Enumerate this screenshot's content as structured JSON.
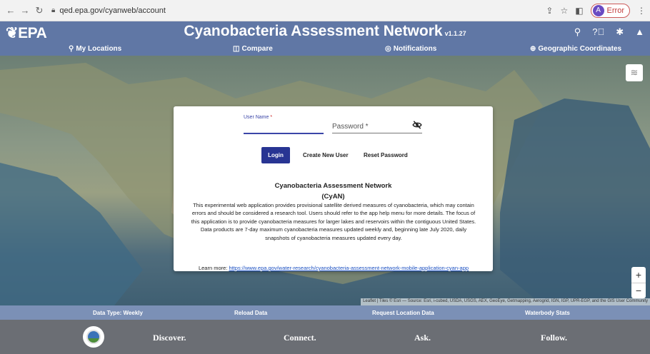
{
  "browser": {
    "url": "qed.epa.gov/cyanweb/account",
    "profile_initial": "A",
    "profile_status": "Error"
  },
  "header": {
    "logo": "EPA",
    "title": "Cyanobacteria Assessment Network",
    "version": "v1.1.27",
    "nav": {
      "my_locations": "My Locations",
      "compare": "Compare",
      "notifications": "Notifications",
      "geographic_coordinates": "Geographic Coordinates"
    }
  },
  "login": {
    "username_label": "User Name",
    "required_mark": "*",
    "password_label": "Password *",
    "login_button": "Login",
    "create_user": "Create New User",
    "reset_password": "Reset Password",
    "title_line1": "Cyanobacteria Assessment Network",
    "title_line2": "(CyAN)",
    "description": "This experimental web application provides provisional satellite derived measures of cyanobacteria, which may contain errors and should be considered a research tool. Users should refer to the app help menu for more details. The focus of this application is to provide cyanobacteria measures for larger lakes and reservoirs within the contiguous United States. Data products are 7-day maximum cyanobacteria measures updated weekly and, beginning late July 2020, daily snapshots of cyanobacteria measures updated every day.",
    "learn_more_label": "Learn more:",
    "learn_more_link": "https://www.epa.gov/water-research/cyanobacteria-assessment-network-mobile-application-cyan-app"
  },
  "map": {
    "zoom_in": "+",
    "zoom_out": "−",
    "attribution": "Leaflet | Tiles © Esri — Source: Esri, i-cubed, USDA, USGS, AEX, GeoEye, Getmapping, Aerogrid, IGN, IGP, UPR-EGP, and the GIS User Community"
  },
  "data_bar": {
    "data_type": "Data Type: Weekly",
    "reload": "Reload Data",
    "request": "Request Location Data",
    "waterbody": "Waterbody Stats"
  },
  "footer": {
    "discover": "Discover.",
    "connect": "Connect.",
    "ask": "Ask.",
    "follow": "Follow."
  }
}
